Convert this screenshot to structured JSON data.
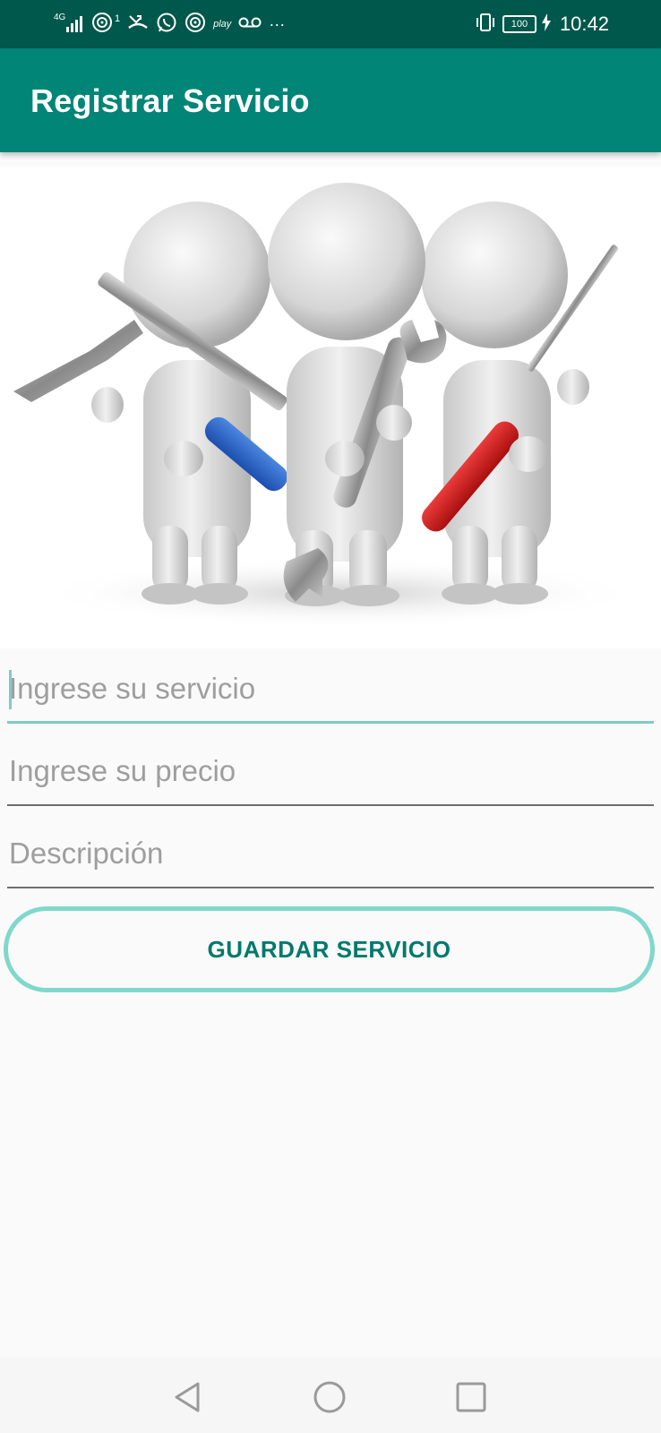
{
  "status_bar": {
    "network": "4G",
    "notification_count": "1",
    "play_label": "play",
    "more": "···",
    "battery": "100",
    "time": "10:42",
    "icons": [
      "signal-icon",
      "hotspot-icon",
      "missed-call-icon",
      "whatsapp-icon",
      "hotspot-icon",
      "play-icon",
      "voicemail-icon",
      "more-icon",
      "vibrate-icon",
      "battery-icon",
      "charging-icon"
    ]
  },
  "app_bar": {
    "title": "Registrar Servicio"
  },
  "hero": {
    "image": "three-figures-with-tools-illustration"
  },
  "form": {
    "service": {
      "placeholder": "Ingrese su servicio",
      "value": ""
    },
    "price": {
      "placeholder": "Ingrese su precio",
      "value": ""
    },
    "description": {
      "placeholder": "Descripción",
      "value": ""
    },
    "save_label": "GUARDAR SERVICIO"
  },
  "nav_bar": {
    "icons": [
      "back-icon",
      "home-icon",
      "recents-icon"
    ]
  },
  "colors": {
    "status_bar": "#00574b",
    "primary": "#008577",
    "accent": "#80cbc4",
    "button_text": "#00796b"
  }
}
